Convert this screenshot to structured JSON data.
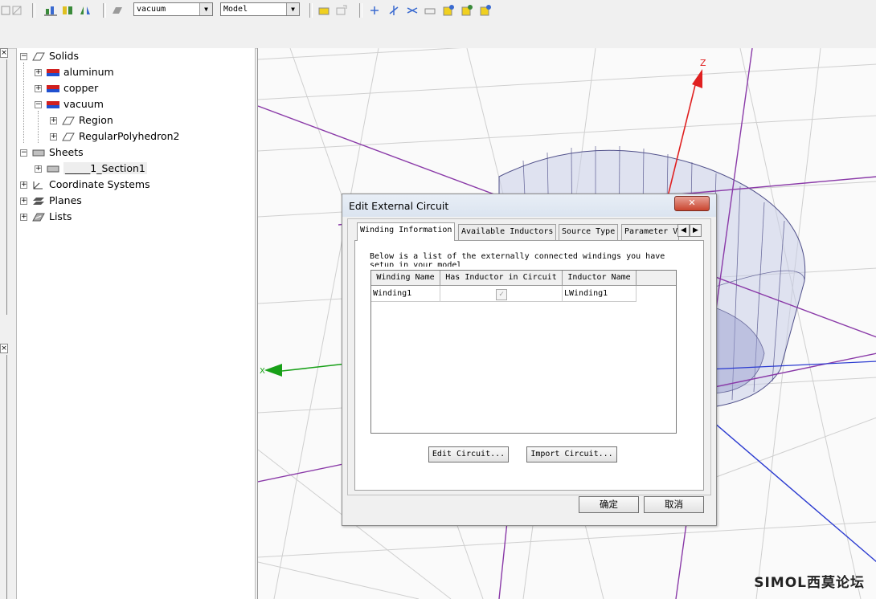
{
  "toolbar": {
    "material_combo": "vacuum",
    "view_combo": "Model"
  },
  "tree": {
    "items": [
      {
        "label": "Solids"
      },
      {
        "label": "aluminum"
      },
      {
        "label": "copper"
      },
      {
        "label": "vacuum"
      },
      {
        "label": "Region"
      },
      {
        "label": "RegularPolyhedron2"
      },
      {
        "label": "Sheets"
      },
      {
        "label": "_____1_Section1"
      },
      {
        "label": "Coordinate Systems"
      },
      {
        "label": "Planes"
      },
      {
        "label": "Lists"
      }
    ]
  },
  "viewport": {
    "axis_z": "Z",
    "axis_x": "X"
  },
  "dialog": {
    "title": "Edit External Circuit",
    "tabs": [
      "Winding Information",
      "Available Inductors",
      "Source Type",
      "Parameter V"
    ],
    "description": "Below is a list of the externally connected windings you have setup in your model",
    "columns": [
      "Winding Name",
      "Has Inductor in Circuit",
      "Inductor Name"
    ],
    "rows": [
      {
        "winding": "Winding1",
        "has_inductor": true,
        "inductor": "LWinding1"
      }
    ],
    "edit_circuit": "Edit Circuit...",
    "import_circuit": "Import Circuit...",
    "ok": "确定",
    "cancel": "取消"
  },
  "watermark": "SIMOL西莫论坛",
  "colors": {
    "z_axis": "#e02020",
    "x_axis": "#18a018",
    "grid": "#c8c8c8",
    "purple_line": "#8a3aa8",
    "blue_line": "#2a3ad0",
    "cylinder": "#c9cde8"
  }
}
